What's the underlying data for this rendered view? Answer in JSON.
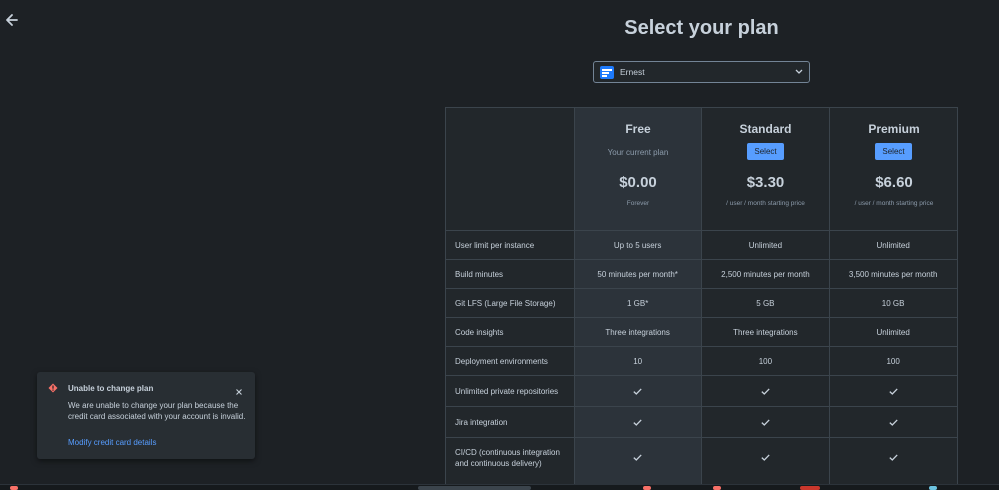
{
  "header": {
    "back_icon": "arrow-left-icon",
    "title": "Select your plan"
  },
  "workspace": {
    "selected": "Ernest",
    "avatar_icon": "workspace-avatar-icon",
    "chevron_icon": "chevron-down-icon"
  },
  "plans": [
    {
      "name": "Free",
      "current_label": "Your current plan",
      "price": "$0.00",
      "price_note": "Forever"
    },
    {
      "name": "Standard",
      "select_label": "Select",
      "price": "$3.30",
      "price_note": "/ user / month starting price"
    },
    {
      "name": "Premium",
      "select_label": "Select",
      "price": "$6.60",
      "price_note": "/ user / month starting price"
    }
  ],
  "features": [
    {
      "label": "User limit per instance",
      "values": [
        "Up to 5 users",
        "Unlimited",
        "Unlimited"
      ]
    },
    {
      "label": "Build minutes",
      "values": [
        "50 minutes per month*",
        "2,500 minutes per month",
        "3,500 minutes per month"
      ]
    },
    {
      "label": "Git LFS (Large File Storage)",
      "values": [
        "1 GB*",
        "5 GB",
        "10 GB"
      ]
    },
    {
      "label": "Code insights",
      "values": [
        "Three integrations",
        "Three integrations",
        "Unlimited"
      ]
    },
    {
      "label": "Deployment environments",
      "values": [
        "10",
        "100",
        "100"
      ]
    },
    {
      "label": "Unlimited private repositories",
      "values": [
        "check",
        "check",
        "check"
      ]
    },
    {
      "label": "Jira integration",
      "values": [
        "check",
        "check",
        "check"
      ]
    },
    {
      "label": "CI/CD (continuous integration and continuous delivery)",
      "values": [
        "check",
        "check",
        "check"
      ]
    }
  ],
  "flag": {
    "icon": "error-icon",
    "title": "Unable to change plan",
    "body": "We are unable to change your plan because the credit card associated with your account is invalid.",
    "link": "Modify credit card details",
    "close_icon": "close-icon"
  },
  "colors": {
    "background": "#1d2125",
    "accent": "#579dff",
    "error": "#f87168",
    "surface": "#22272b"
  }
}
